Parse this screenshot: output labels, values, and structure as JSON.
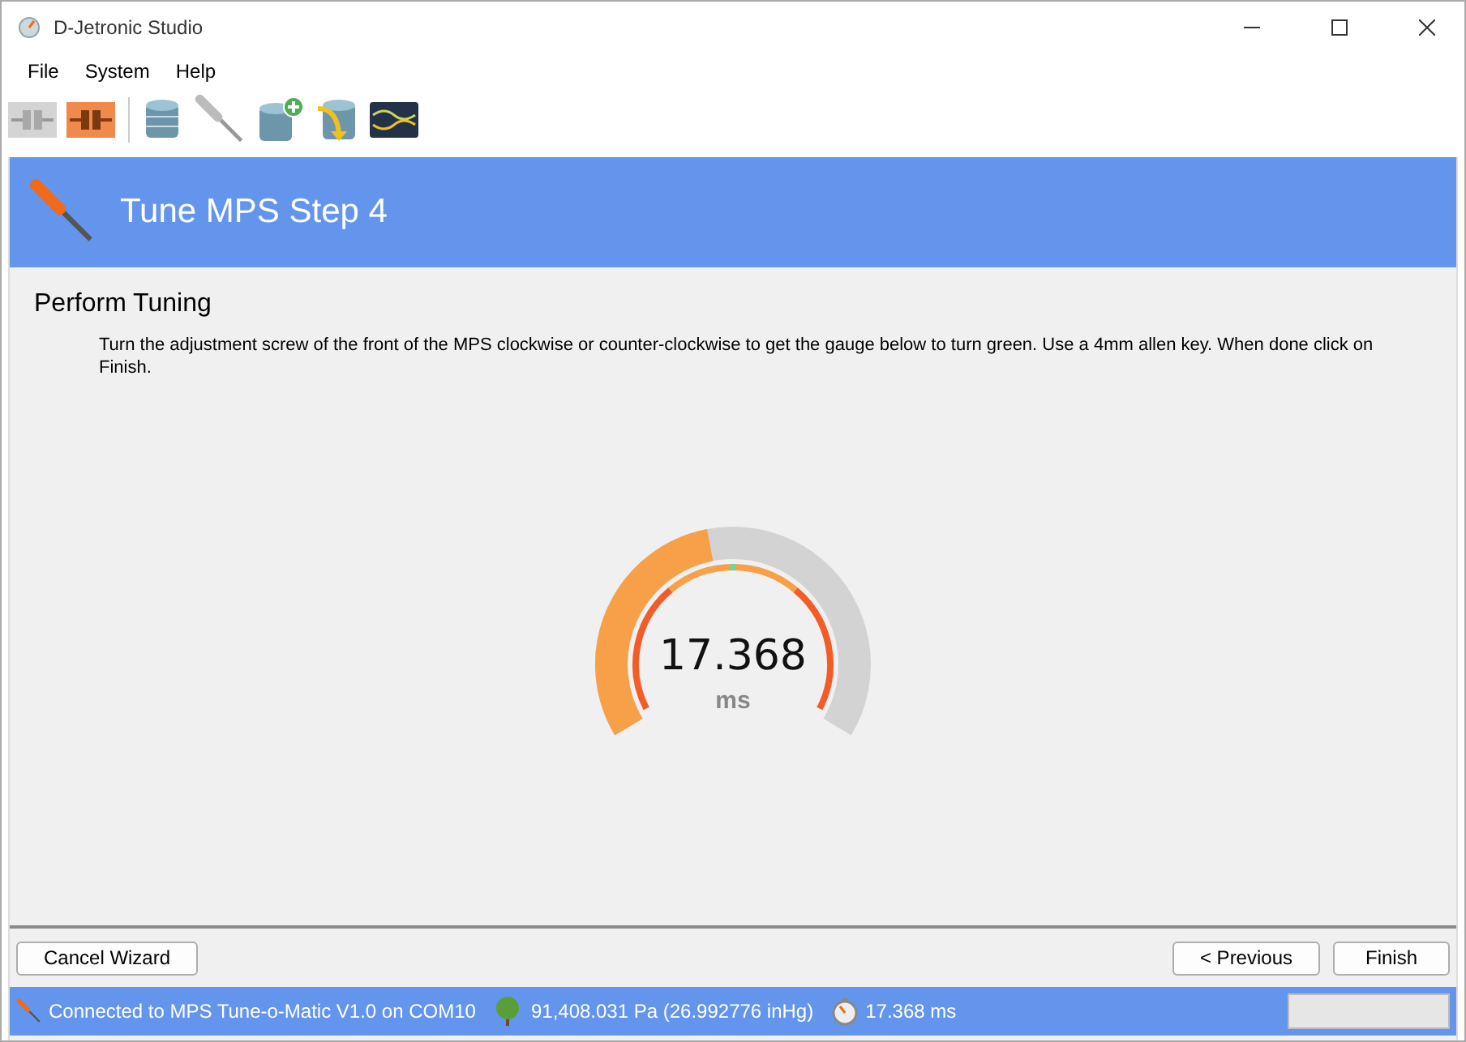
{
  "window": {
    "title": "D-Jetronic Studio"
  },
  "menu": [
    "File",
    "System",
    "Help"
  ],
  "header": {
    "title": "Tune MPS Step 4"
  },
  "section": {
    "title": "Perform Tuning",
    "instructions": "Turn the adjustment screw of the front of the MPS clockwise or counter-clockwise to get the gauge below to turn green. Use a 4mm allen key. When done click on Finish."
  },
  "gauge": {
    "reading": "17.368",
    "unit": "ms",
    "level": 0.455
  },
  "buttons": {
    "cancel": "Cancel Wizard",
    "previous": "< Previous",
    "finish": "Finish"
  },
  "status_bar": {
    "connection": "Connected to MPS Tune-o-Matic V1.0 on COM10",
    "pressure": "91,408.031 Pa (26.992776 inHg)",
    "timing": "17.368 ms",
    "progress": {
      "level": 0
    }
  }
}
